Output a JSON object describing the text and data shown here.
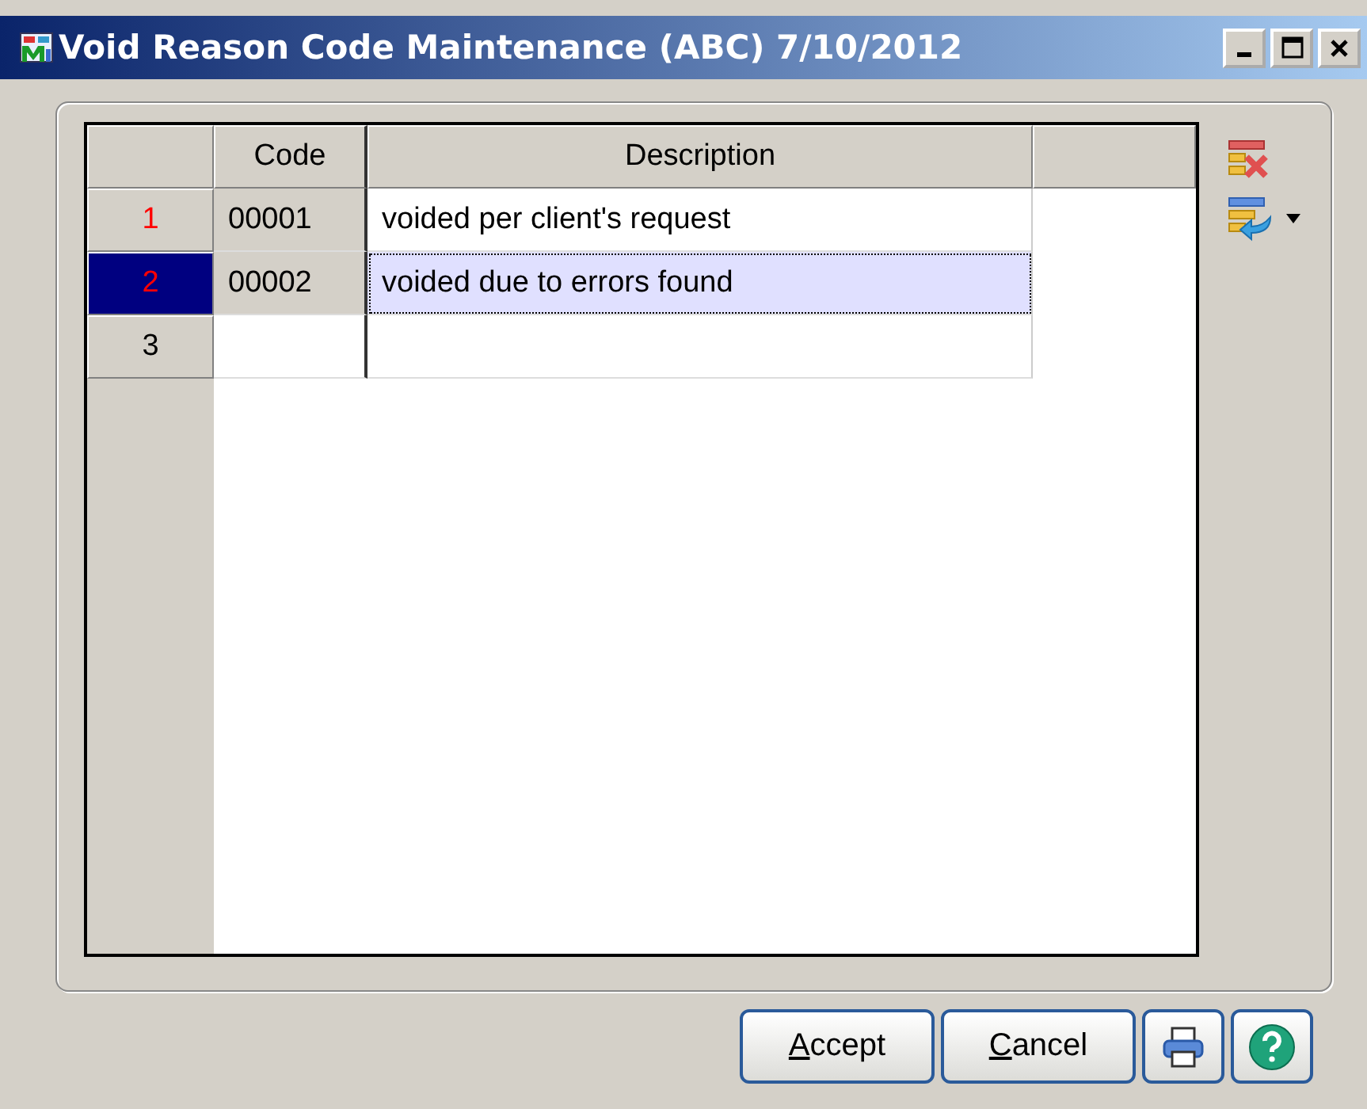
{
  "window": {
    "title": "Void Reason Code Maintenance (ABC) 7/10/2012"
  },
  "table": {
    "columns": [
      "Code",
      "Description"
    ],
    "rows": [
      {
        "number": "1",
        "kind": "record",
        "selected": false,
        "code": "00001",
        "description": "voided per client's request"
      },
      {
        "number": "2",
        "kind": "record",
        "selected": true,
        "code": "00002",
        "description": "voided due to errors found"
      },
      {
        "number": "3",
        "kind": "new",
        "selected": false
      }
    ]
  },
  "buttons": [
    {
      "kind": "text",
      "label": "Accept"
    },
    {
      "kind": "text",
      "label": "Cancel"
    },
    {
      "kind": "print"
    },
    {
      "kind": "help"
    }
  ]
}
